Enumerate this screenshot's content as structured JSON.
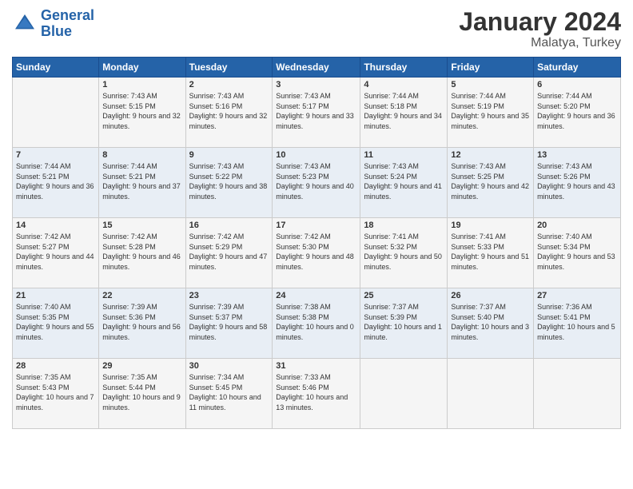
{
  "header": {
    "logo_line1": "General",
    "logo_line2": "Blue",
    "month": "January 2024",
    "location": "Malatya, Turkey"
  },
  "days_of_week": [
    "Sunday",
    "Monday",
    "Tuesday",
    "Wednesday",
    "Thursday",
    "Friday",
    "Saturday"
  ],
  "weeks": [
    [
      {
        "day": "",
        "sunrise": "",
        "sunset": "",
        "daylight": ""
      },
      {
        "day": "1",
        "sunrise": "Sunrise: 7:43 AM",
        "sunset": "Sunset: 5:15 PM",
        "daylight": "Daylight: 9 hours and 32 minutes."
      },
      {
        "day": "2",
        "sunrise": "Sunrise: 7:43 AM",
        "sunset": "Sunset: 5:16 PM",
        "daylight": "Daylight: 9 hours and 32 minutes."
      },
      {
        "day": "3",
        "sunrise": "Sunrise: 7:43 AM",
        "sunset": "Sunset: 5:17 PM",
        "daylight": "Daylight: 9 hours and 33 minutes."
      },
      {
        "day": "4",
        "sunrise": "Sunrise: 7:44 AM",
        "sunset": "Sunset: 5:18 PM",
        "daylight": "Daylight: 9 hours and 34 minutes."
      },
      {
        "day": "5",
        "sunrise": "Sunrise: 7:44 AM",
        "sunset": "Sunset: 5:19 PM",
        "daylight": "Daylight: 9 hours and 35 minutes."
      },
      {
        "day": "6",
        "sunrise": "Sunrise: 7:44 AM",
        "sunset": "Sunset: 5:20 PM",
        "daylight": "Daylight: 9 hours and 36 minutes."
      }
    ],
    [
      {
        "day": "7",
        "sunrise": "Sunrise: 7:44 AM",
        "sunset": "Sunset: 5:21 PM",
        "daylight": "Daylight: 9 hours and 36 minutes."
      },
      {
        "day": "8",
        "sunrise": "Sunrise: 7:44 AM",
        "sunset": "Sunset: 5:21 PM",
        "daylight": "Daylight: 9 hours and 37 minutes."
      },
      {
        "day": "9",
        "sunrise": "Sunrise: 7:43 AM",
        "sunset": "Sunset: 5:22 PM",
        "daylight": "Daylight: 9 hours and 38 minutes."
      },
      {
        "day": "10",
        "sunrise": "Sunrise: 7:43 AM",
        "sunset": "Sunset: 5:23 PM",
        "daylight": "Daylight: 9 hours and 40 minutes."
      },
      {
        "day": "11",
        "sunrise": "Sunrise: 7:43 AM",
        "sunset": "Sunset: 5:24 PM",
        "daylight": "Daylight: 9 hours and 41 minutes."
      },
      {
        "day": "12",
        "sunrise": "Sunrise: 7:43 AM",
        "sunset": "Sunset: 5:25 PM",
        "daylight": "Daylight: 9 hours and 42 minutes."
      },
      {
        "day": "13",
        "sunrise": "Sunrise: 7:43 AM",
        "sunset": "Sunset: 5:26 PM",
        "daylight": "Daylight: 9 hours and 43 minutes."
      }
    ],
    [
      {
        "day": "14",
        "sunrise": "Sunrise: 7:42 AM",
        "sunset": "Sunset: 5:27 PM",
        "daylight": "Daylight: 9 hours and 44 minutes."
      },
      {
        "day": "15",
        "sunrise": "Sunrise: 7:42 AM",
        "sunset": "Sunset: 5:28 PM",
        "daylight": "Daylight: 9 hours and 46 minutes."
      },
      {
        "day": "16",
        "sunrise": "Sunrise: 7:42 AM",
        "sunset": "Sunset: 5:29 PM",
        "daylight": "Daylight: 9 hours and 47 minutes."
      },
      {
        "day": "17",
        "sunrise": "Sunrise: 7:42 AM",
        "sunset": "Sunset: 5:30 PM",
        "daylight": "Daylight: 9 hours and 48 minutes."
      },
      {
        "day": "18",
        "sunrise": "Sunrise: 7:41 AM",
        "sunset": "Sunset: 5:32 PM",
        "daylight": "Daylight: 9 hours and 50 minutes."
      },
      {
        "day": "19",
        "sunrise": "Sunrise: 7:41 AM",
        "sunset": "Sunset: 5:33 PM",
        "daylight": "Daylight: 9 hours and 51 minutes."
      },
      {
        "day": "20",
        "sunrise": "Sunrise: 7:40 AM",
        "sunset": "Sunset: 5:34 PM",
        "daylight": "Daylight: 9 hours and 53 minutes."
      }
    ],
    [
      {
        "day": "21",
        "sunrise": "Sunrise: 7:40 AM",
        "sunset": "Sunset: 5:35 PM",
        "daylight": "Daylight: 9 hours and 55 minutes."
      },
      {
        "day": "22",
        "sunrise": "Sunrise: 7:39 AM",
        "sunset": "Sunset: 5:36 PM",
        "daylight": "Daylight: 9 hours and 56 minutes."
      },
      {
        "day": "23",
        "sunrise": "Sunrise: 7:39 AM",
        "sunset": "Sunset: 5:37 PM",
        "daylight": "Daylight: 9 hours and 58 minutes."
      },
      {
        "day": "24",
        "sunrise": "Sunrise: 7:38 AM",
        "sunset": "Sunset: 5:38 PM",
        "daylight": "Daylight: 10 hours and 0 minutes."
      },
      {
        "day": "25",
        "sunrise": "Sunrise: 7:37 AM",
        "sunset": "Sunset: 5:39 PM",
        "daylight": "Daylight: 10 hours and 1 minute."
      },
      {
        "day": "26",
        "sunrise": "Sunrise: 7:37 AM",
        "sunset": "Sunset: 5:40 PM",
        "daylight": "Daylight: 10 hours and 3 minutes."
      },
      {
        "day": "27",
        "sunrise": "Sunrise: 7:36 AM",
        "sunset": "Sunset: 5:41 PM",
        "daylight": "Daylight: 10 hours and 5 minutes."
      }
    ],
    [
      {
        "day": "28",
        "sunrise": "Sunrise: 7:35 AM",
        "sunset": "Sunset: 5:43 PM",
        "daylight": "Daylight: 10 hours and 7 minutes."
      },
      {
        "day": "29",
        "sunrise": "Sunrise: 7:35 AM",
        "sunset": "Sunset: 5:44 PM",
        "daylight": "Daylight: 10 hours and 9 minutes."
      },
      {
        "day": "30",
        "sunrise": "Sunrise: 7:34 AM",
        "sunset": "Sunset: 5:45 PM",
        "daylight": "Daylight: 10 hours and 11 minutes."
      },
      {
        "day": "31",
        "sunrise": "Sunrise: 7:33 AM",
        "sunset": "Sunset: 5:46 PM",
        "daylight": "Daylight: 10 hours and 13 minutes."
      },
      {
        "day": "",
        "sunrise": "",
        "sunset": "",
        "daylight": ""
      },
      {
        "day": "",
        "sunrise": "",
        "sunset": "",
        "daylight": ""
      },
      {
        "day": "",
        "sunrise": "",
        "sunset": "",
        "daylight": ""
      }
    ]
  ]
}
